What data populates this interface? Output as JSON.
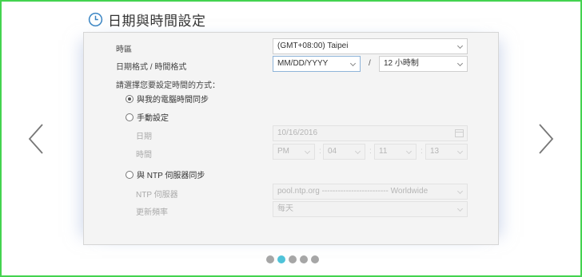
{
  "header": {
    "title": "日期與時間設定",
    "icon": "clock-icon"
  },
  "form": {
    "timezone": {
      "label": "時區",
      "value": "(GMT+08:00) Taipei"
    },
    "format": {
      "label": "日期格式 / 時間格式",
      "date_value": "MM/DD/YYYY",
      "separator": "/",
      "time_value": "12 小時制"
    },
    "method_prompt": "請選擇您要設定時間的方式：",
    "options": {
      "sync_pc": {
        "label": "與我的電腦時間同步",
        "checked": true
      },
      "manual": {
        "label": "手動設定",
        "checked": false,
        "date": {
          "label": "日期",
          "value": "10/16/2016"
        },
        "time": {
          "label": "時間",
          "ampm": "PM",
          "hour": "04",
          "minute": "11",
          "second": "13",
          "sep": ":"
        }
      },
      "ntp": {
        "label": "與 NTP 伺服器同步",
        "checked": false,
        "server": {
          "label": "NTP 伺服器",
          "value": "pool.ntp.org ------------------------- Worldwide"
        },
        "frequency": {
          "label": "更新頻率",
          "value": "每天"
        }
      }
    }
  },
  "carousel": {
    "page_count": 5,
    "active_index": 1
  },
  "colors": {
    "frame_border": "#44d34f",
    "active_dot": "#4fc3d9",
    "inactive_dot": "#a6a6a6"
  }
}
